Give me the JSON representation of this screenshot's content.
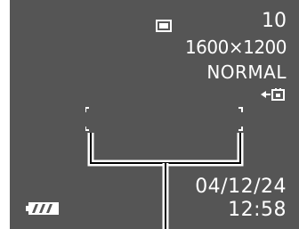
{
  "status": {
    "shots_remaining": "10",
    "image_size": "1600×1200",
    "quality": "NORMAL",
    "date": "04/12/24",
    "time": "12:58"
  },
  "icons": {
    "recording_mode": "single-shot-mode-icon",
    "memory": "built-in-memory-icon",
    "battery": "battery-icon"
  },
  "colors": {
    "screen_background": "#555555",
    "text": "#ffffff",
    "border": "#ffffff"
  },
  "battery_level": 1.0
}
